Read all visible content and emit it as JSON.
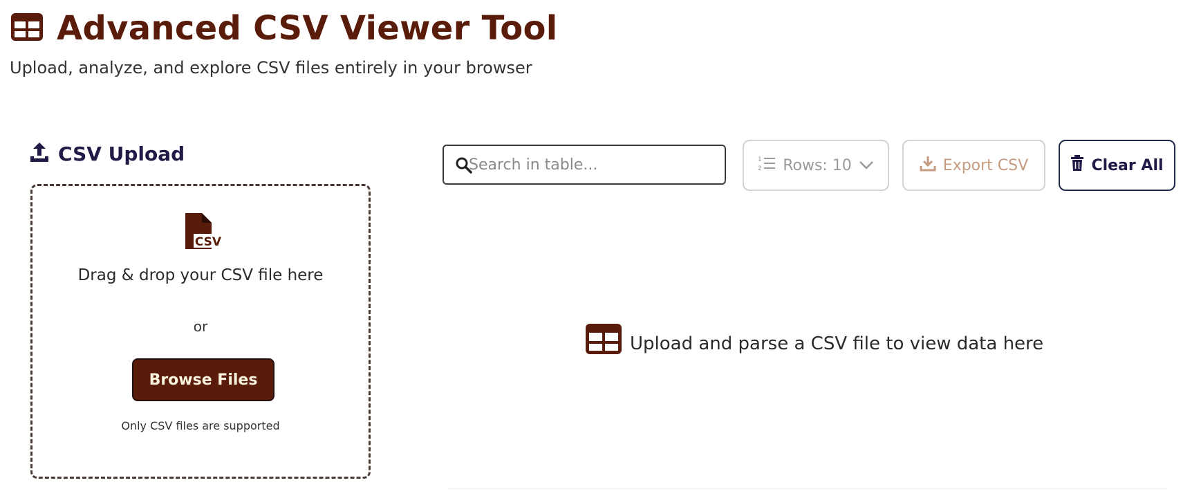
{
  "header": {
    "title": "Advanced CSV Viewer Tool",
    "subtitle": "Upload, analyze, and explore CSV files entirely in your browser",
    "icon": "table-icon"
  },
  "upload": {
    "heading": "CSV Upload",
    "heading_icon": "upload-icon",
    "file_icon": "csv-file-icon",
    "file_icon_label": "CSV",
    "dropzone_title": "Drag & drop your CSV file here",
    "or_label": "or",
    "browse_label": "Browse Files",
    "note": "Only CSV files are supported"
  },
  "toolbar": {
    "search_placeholder": "Search in table...",
    "rows_label": "Rows: 10",
    "export_label": "Export CSV",
    "clear_label": "Clear All"
  },
  "data_area": {
    "empty_message": "Upload and parse a CSV file to view data here",
    "empty_icon": "table-icon"
  },
  "colors": {
    "brand": "#5a1c0a",
    "heading": "#1f1a46",
    "button_text": "#fbf4df",
    "muted": "#9a9a9a",
    "export": "#c49a80"
  }
}
